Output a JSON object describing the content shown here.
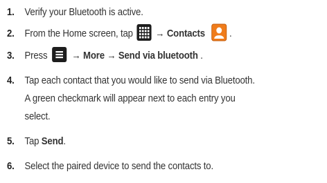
{
  "steps": [
    {
      "num": "1.",
      "text": "Verify your Bluetooth is active."
    },
    {
      "num": "2.",
      "pre": "From the Home screen, tap",
      "arrow": "→",
      "bold": "Contacts",
      "post": "."
    },
    {
      "num": "3.",
      "pre": "Press",
      "bold": "→ More → Send via bluetooth",
      "post": "."
    },
    {
      "num": "4.",
      "lines": [
        "Tap each contact that you would like to send via Bluetooth.",
        "A green checkmark will appear next to each entry you",
        "select."
      ]
    },
    {
      "num": "5.",
      "pre": "Tap",
      "bold": "Send",
      "post": "."
    },
    {
      "num": "6.",
      "text": "Select the paired device to send the contacts to."
    }
  ],
  "icons": {
    "applications": "apps-grid-icon",
    "contacts": "contacts-icon",
    "menu": "menu-key-icon"
  },
  "colors": {
    "text": "#333333",
    "icon_dark": "#1d1d1d",
    "contacts_orange": "#f07c1b"
  }
}
